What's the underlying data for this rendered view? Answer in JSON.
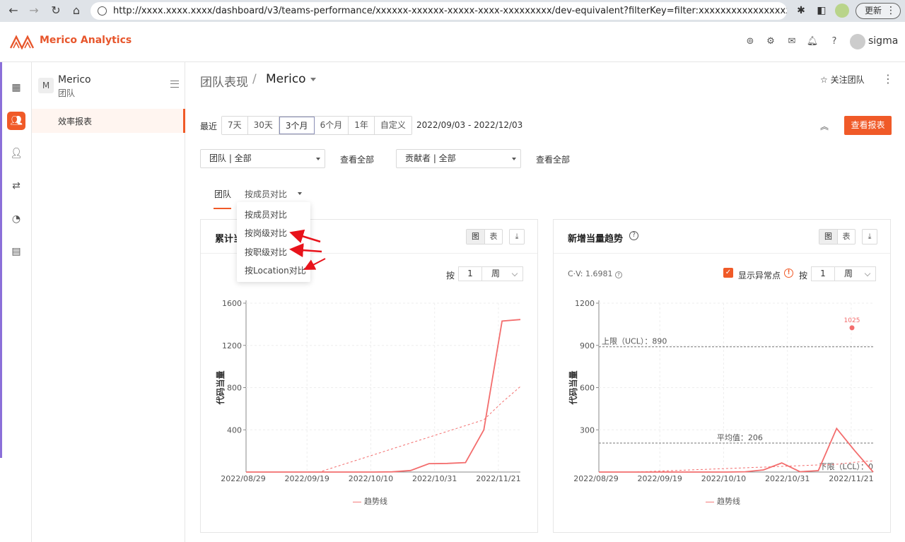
{
  "browser": {
    "url": "http://xxxx.xxxx.xxxx/dashboard/v3/teams-performance/xxxxxx-xxxxxx-xxxxx-xxxx-xxxxxxxxx/dev-equivalent?filterKey=filter:xxxxxxxxxxxxxxxxxxxx",
    "update_label": "更新"
  },
  "app": {
    "brand": "Merico Analytics",
    "username": "sigma",
    "header_icons": [
      "analytics-icon",
      "settings-icon",
      "mail-icon",
      "bell-icon",
      "help-icon"
    ]
  },
  "rail": {
    "items": [
      "board-icon",
      "team-icon",
      "user-icon",
      "flow-icon",
      "history-icon",
      "archive-icon"
    ]
  },
  "sidebar": {
    "team_initial": "M",
    "team_name": "Merico",
    "team_type": "团队",
    "items": [
      {
        "label": "效率报表",
        "active": true
      }
    ]
  },
  "breadcrumb": {
    "parent": "团队表现",
    "separator": "/",
    "current": "Merico"
  },
  "actions": {
    "follow": "关注团队",
    "view_report": "查看报表"
  },
  "time_range": {
    "label": "最近",
    "options": [
      "7天",
      "30天",
      "3个月",
      "6个月",
      "1年",
      "自定义"
    ],
    "selected": "3个月",
    "dates": "2022/09/03 - 2022/12/03"
  },
  "filters": {
    "team_select": "团队 | 全部",
    "team_view_all": "查看全部",
    "contributor_select": "贡献者 | 全部",
    "contributor_view_all": "查看全部"
  },
  "tabs": {
    "team": "团队",
    "compare": "按成员对比"
  },
  "dropdown": {
    "items": [
      "按成员对比",
      "按岗级对比",
      "按职级对比",
      "按Location对比"
    ]
  },
  "card_left": {
    "title": "累计当",
    "seg_chart": "图",
    "seg_table": "表",
    "period_label": "按",
    "period_value": "1",
    "period_unit": "周",
    "legend": "趋势线"
  },
  "card_right": {
    "title": "新增当量趋势",
    "seg_chart": "图",
    "seg_table": "表",
    "cv": "C·V: 1.6981",
    "show_anomaly": "显示异常点",
    "period_label": "按",
    "period_value": "1",
    "period_unit": "周",
    "legend": "趋势线"
  },
  "chart_data": [
    {
      "type": "line",
      "title": "累计当",
      "ylabel": "代码当量",
      "ylim": [
        0,
        1600
      ],
      "yticks": [
        400,
        800,
        1200,
        1600
      ],
      "xticks": [
        "2022/08/29",
        "2022/09/19",
        "2022/10/10",
        "2022/10/31",
        "2022/11/21"
      ],
      "series": [
        {
          "values": [
            0,
            0,
            0,
            0,
            0,
            0,
            0,
            0,
            2,
            15,
            80,
            82,
            90,
            400,
            1430,
            1445
          ]
        },
        {
          "name": "趋势线",
          "style": "dashed",
          "values": [
            0,
            0,
            0,
            0,
            0,
            55,
            110,
            165,
            220,
            275,
            330,
            385,
            440,
            495,
            660,
            810
          ]
        }
      ],
      "color": "#f36d6d",
      "grid": true,
      "legend_position": "bottom"
    },
    {
      "type": "line",
      "title": "新增当量趋势",
      "ylabel": "代码当量",
      "ylim": [
        0,
        1200
      ],
      "yticks": [
        300,
        600,
        900,
        1200
      ],
      "xticks": [
        "2022/08/29",
        "2022/09/19",
        "2022/10/10",
        "2022/10/31",
        "2022/11/21"
      ],
      "series": [
        {
          "values": [
            0,
            0,
            0,
            0,
            0,
            0,
            0,
            0,
            2,
            15,
            65,
            2,
            10,
            310,
            150,
            0
          ]
        },
        {
          "name": "趋势线",
          "style": "dashed",
          "values": [
            0,
            0,
            0,
            5,
            10,
            15,
            20,
            25,
            30,
            35,
            40,
            45,
            50,
            55,
            70,
            80
          ]
        }
      ],
      "anomalies": [
        {
          "label": "1025",
          "value": 1025
        }
      ],
      "reference_lines": [
        {
          "label": "上限（UCL）：890",
          "value": 890
        },
        {
          "label": "平均值：206",
          "value": 206
        },
        {
          "label": "下限（LCL）：0",
          "value": 0
        }
      ],
      "color": "#f36d6d",
      "grid": true,
      "legend_position": "bottom"
    }
  ]
}
